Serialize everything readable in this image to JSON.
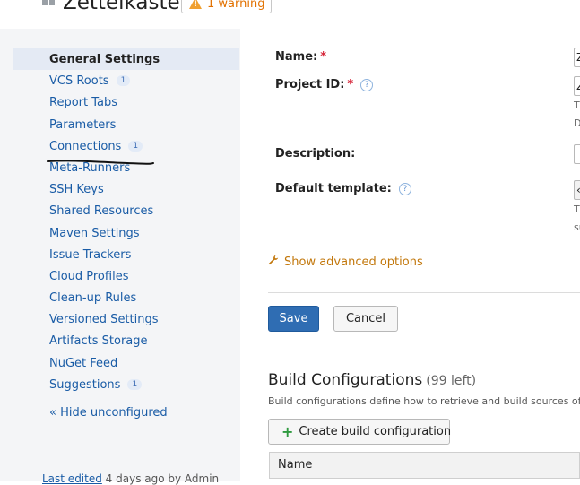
{
  "header": {
    "title": "Zettelkasten",
    "warning": "1 warning"
  },
  "sidebar": {
    "items": [
      {
        "label": "General Settings",
        "badge": ""
      },
      {
        "label": "VCS Roots",
        "badge": "1"
      },
      {
        "label": "Report Tabs",
        "badge": ""
      },
      {
        "label": "Parameters",
        "badge": ""
      },
      {
        "label": "Connections",
        "badge": "1"
      },
      {
        "label": "Meta-Runners",
        "badge": ""
      },
      {
        "label": "SSH Keys",
        "badge": ""
      },
      {
        "label": "Shared Resources",
        "badge": ""
      },
      {
        "label": "Maven Settings",
        "badge": ""
      },
      {
        "label": "Issue Trackers",
        "badge": ""
      },
      {
        "label": "Cloud Profiles",
        "badge": ""
      },
      {
        "label": "Clean-up Rules",
        "badge": ""
      },
      {
        "label": "Versioned Settings",
        "badge": ""
      },
      {
        "label": "Artifacts Storage",
        "badge": ""
      },
      {
        "label": "NuGet Feed",
        "badge": ""
      },
      {
        "label": "Suggestions",
        "badge": "1"
      }
    ],
    "hide_unconfigured": "« Hide unconfigured",
    "footer": {
      "link": "Last edited",
      "rest": " 4 days ago by Admin"
    }
  },
  "form": {
    "name_label": "Name:",
    "project_id_label": "Project ID:",
    "description_label": "Description:",
    "default_template_label": "Default template:",
    "required_mark": "*",
    "help_glyph": "?",
    "name_value": "Z",
    "project_id_value": "Z",
    "project_id_hint_1": "T",
    "project_id_hint_2": "D",
    "template_value": "‹",
    "template_hint_1": "T",
    "template_hint_2": "su",
    "show_advanced": "Show advanced options",
    "save": "Save",
    "cancel": "Cancel"
  },
  "build_configs": {
    "title": "Build Configurations",
    "left": "(99 left)",
    "description": "Build configurations define how to retrieve and build sources of",
    "create_button": "Create build configuration",
    "table_header": "Name"
  },
  "colors": {
    "link": "#1a5ca6",
    "primary": "#2f6db3",
    "warning": "#e27100",
    "required": "#d6263a"
  },
  "icons": [
    "grid-icon",
    "warning-icon",
    "help-icon",
    "wrench-icon",
    "plus-icon"
  ]
}
